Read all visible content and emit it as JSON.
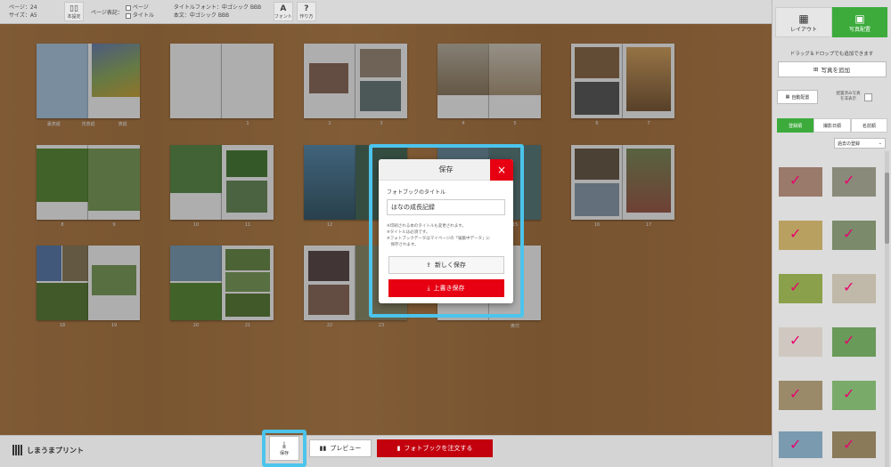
{
  "topbar": {
    "pages_line": "ページ：24",
    "size_line": "サイズ：A5",
    "settings_label": "本設定",
    "page_display_label": "ページ表記：",
    "opt_page": "ページ",
    "opt_title": "タイトル",
    "title_font": "タイトルフォント：中ゴシック BBB",
    "body_font": "本文：中ゴシック BBB",
    "font_btn_glyph": "A",
    "font_btn_label": "フォント",
    "howto_btn_glyph": "?",
    "howto_btn_label": "作り方"
  },
  "spreads": [
    {
      "labels": [
        "裏表紙",
        "背表紙",
        "表紙"
      ]
    },
    {
      "labels": [
        "",
        "1"
      ]
    },
    {
      "labels": [
        "2",
        "3"
      ]
    },
    {
      "labels": [
        "4",
        "5"
      ]
    },
    {
      "labels": [
        "6",
        "7"
      ]
    },
    {
      "labels": [
        "8",
        "9"
      ]
    },
    {
      "labels": [
        "10",
        "11"
      ]
    },
    {
      "labels": [
        "12",
        "13"
      ]
    },
    {
      "labels": [
        "14",
        "15"
      ]
    },
    {
      "labels": [
        "16",
        "17"
      ]
    },
    {
      "labels": [
        "18",
        "19"
      ]
    },
    {
      "labels": [
        "20",
        "21"
      ]
    },
    {
      "labels": [
        "22",
        "23"
      ]
    },
    {
      "labels": [
        "",
        "奥付"
      ]
    }
  ],
  "modal": {
    "title": "保存",
    "close_glyph": "×",
    "field_label": "フォトブックのタイトル",
    "field_value": "はなの成長記録",
    "note1": "※印刷される本のタイトルも変更されます。",
    "note2": "※タイトルは必須です。",
    "note3": "※フォトブックデータはマイページの「編集中データ」に",
    "note4": "　保存されます。",
    "new_save": "新しく保存",
    "overwrite_save": "上書き保存"
  },
  "bottombar": {
    "logo_text": "しまうまプリント",
    "save_label": "保存",
    "preview_label": "プレビュー",
    "order_label": "フォトブックを注文する"
  },
  "sidebar": {
    "tab_layout": "レイアウト",
    "tab_photo": "写真配置",
    "drag_hint": "ドラッグ＆ドロップでも追加できます",
    "add_photo": "写真を追加",
    "auto_place": "自動配置",
    "hide_used": "配置済み写真を非表示",
    "filter_registered": "登録順",
    "filter_date": "撮影日順",
    "filter_name": "名前順",
    "select_value": "過去の登録"
  },
  "colors": {
    "accent_red": "#e60012",
    "accent_green": "#3cab3c",
    "highlight": "#4cc4ec"
  }
}
